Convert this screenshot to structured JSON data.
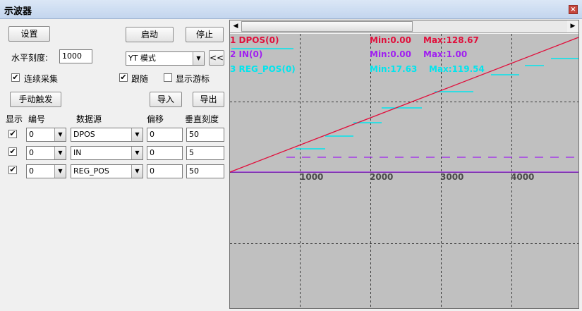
{
  "window": {
    "title": "示波器",
    "close_label": "×"
  },
  "controls": {
    "settings": "设置",
    "start": "启动",
    "stop": "停止",
    "hscale_label": "水平刻度:",
    "hscale_value": "1000",
    "mode_value": "YT 模式",
    "collapse": "<<",
    "continuous": "连续采集",
    "follow": "跟随",
    "cursor": "显示游标",
    "manual_trigger": "手动触发",
    "import": "导入",
    "export": "导出",
    "continuous_checked": true,
    "follow_checked": true,
    "cursor_checked": false
  },
  "channel_table": {
    "headers": {
      "show": "显示",
      "number": "编号",
      "source": "数据源",
      "offset": "偏移",
      "vscale": "垂直刻度"
    },
    "rows": [
      {
        "show": true,
        "number": "0",
        "source": "DPOS",
        "offset": "0",
        "vscale": "50"
      },
      {
        "show": true,
        "number": "0",
        "source": "IN",
        "offset": "0",
        "vscale": "5"
      },
      {
        "show": true,
        "number": "0",
        "source": "REG_POS",
        "offset": "0",
        "vscale": "50"
      }
    ]
  },
  "legend": [
    {
      "label": "1 DPOS(0)",
      "min": "Min:0.00",
      "max": "Max:128.67",
      "color": "#e0103c"
    },
    {
      "label": "2 IN(0)",
      "min": "Min:0.00",
      "max": "Max:1.00",
      "color": "#a020f0"
    },
    {
      "label": "3 REG_POS(0)",
      "min": "Min:17.63",
      "max": "Max:119.54",
      "color": "#00e5ee"
    }
  ],
  "x_ticks": [
    "1000",
    "2000",
    "3000",
    "4000"
  ],
  "colors": {
    "plot_bg": "#c0c0c0",
    "dpos": "#e0103c",
    "in": "#a020f0",
    "reg_pos": "#00e5ee",
    "grid": "#3a3a3a"
  }
}
